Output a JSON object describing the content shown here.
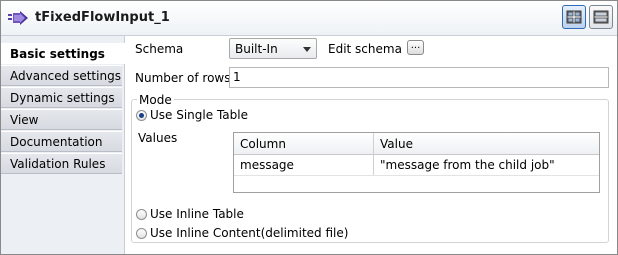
{
  "header": {
    "title": "tFixedFlowInput_1"
  },
  "sidebar": {
    "items": [
      {
        "label": "Basic settings"
      },
      {
        "label": "Advanced settings"
      },
      {
        "label": "Dynamic settings"
      },
      {
        "label": "View"
      },
      {
        "label": "Documentation"
      },
      {
        "label": "Validation Rules"
      }
    ],
    "active": "Basic settings"
  },
  "form": {
    "schema_label": "Schema",
    "schema_value": "Built-In",
    "edit_schema_label": "Edit schema",
    "edit_schema_button": "...",
    "rows_label": "Number of rows",
    "rows_value": "1",
    "mode_label": "Mode",
    "use_single_table": "Use Single Table",
    "values_label": "Values",
    "use_inline_table": "Use Inline Table",
    "use_inline_content": "Use Inline Content(delimited file)",
    "selected_mode": "Use Single Table"
  },
  "values_table": {
    "columns": [
      "Column",
      "Value"
    ],
    "rows": [
      [
        "message",
        "\"message from the child job\""
      ]
    ]
  },
  "icons": {
    "title": "component-arrow-icon",
    "view_buttons": [
      "tabbed-view-icon",
      "stacked-view-icon"
    ]
  },
  "colors": {
    "accent": "#2f6bb8",
    "sidebar_bg": "#eceff3"
  }
}
